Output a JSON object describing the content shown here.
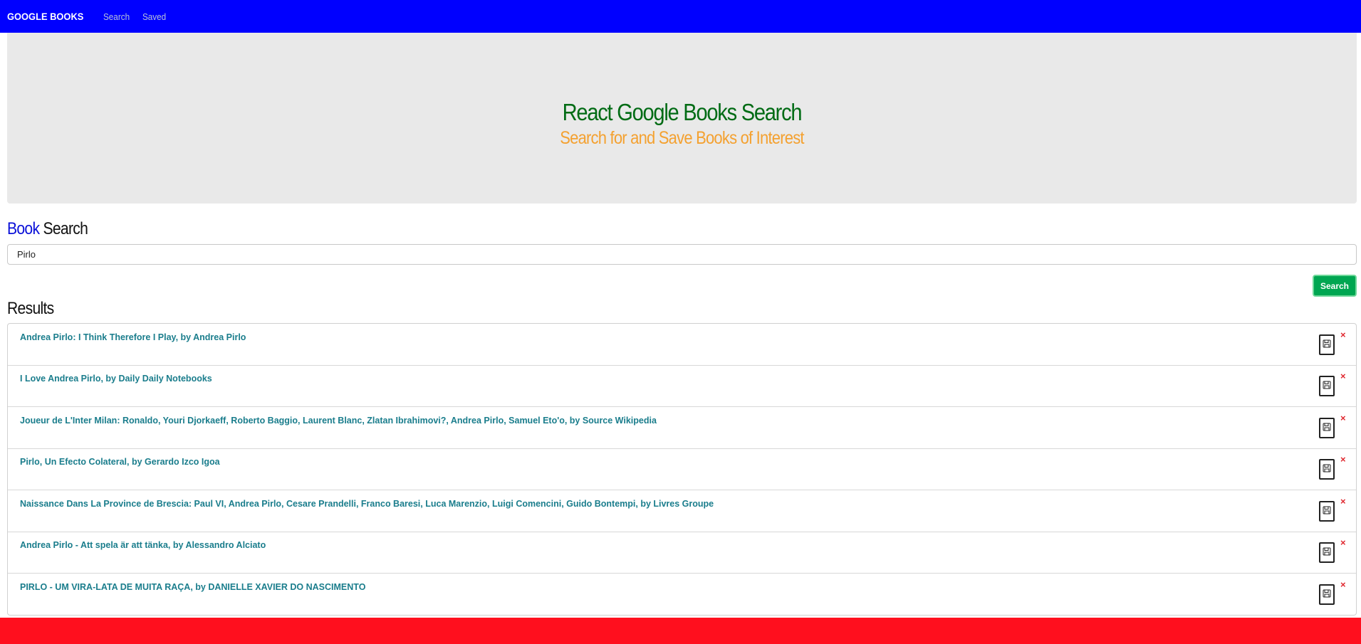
{
  "navbar": {
    "brand": "GOOGLE BOOKS",
    "links": [
      "Search",
      "Saved"
    ]
  },
  "jumbotron": {
    "title": "React Google Books Search",
    "subtitle": "Search for and Save Books of Interest"
  },
  "book_search": {
    "heading_accent": "Book",
    "heading_rest": "Search",
    "input_value": "Pirlo",
    "button_label": "Search"
  },
  "results": {
    "heading": "Results",
    "items": [
      {
        "title": "Andrea Pirlo: I Think Therefore I Play, by Andrea Pirlo"
      },
      {
        "title": "I Love Andrea Pirlo, by Daily Daily Notebooks"
      },
      {
        "title": "Joueur de L'Inter Milan: Ronaldo, Youri Djorkaeff, Roberto Baggio, Laurent Blanc, Zlatan Ibrahimovi?, Andrea Pirlo, Samuel Eto'o, by Source Wikipedia"
      },
      {
        "title": "Pirlo, Un Efecto Colateral, by Gerardo Izco Igoa"
      },
      {
        "title": "Naissance Dans La Province de Brescia: Paul VI, Andrea Pirlo, Cesare Prandelli, Franco Baresi, Luca Marenzio, Luigi Comencini, Guido Bontempi, by Livres Groupe"
      },
      {
        "title": "Andrea Pirlo - Att spela är att tänka, by Alessandro Alciato"
      },
      {
        "title": "PIRLO - UM VIRA-LATA DE MUITA RAÇA, by DANIELLE XAVIER DO NASCIMENTO"
      }
    ],
    "delete_glyph": "×",
    "save_icon": "floppy-disk-icon"
  },
  "colors": {
    "navbar": "#0000ff",
    "jumbotron_bg": "#e9e9e9",
    "title": "#006b14",
    "subtitle": "#f4a130",
    "book_accent": "#0a10d8",
    "search_button": "#00a651",
    "result_text": "#1a7d8c",
    "delete": "#e0282f",
    "footer": "#ff0f1e"
  }
}
